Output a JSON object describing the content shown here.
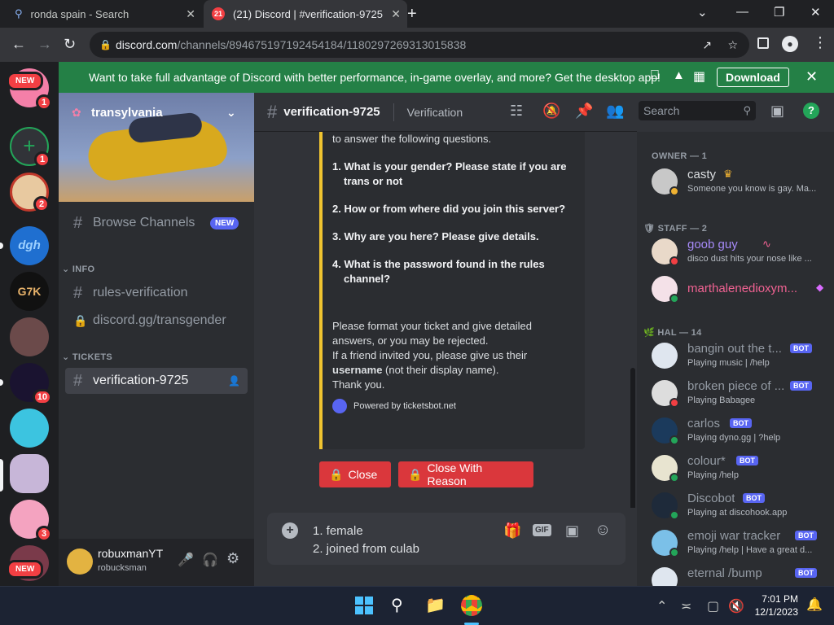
{
  "browser": {
    "tabs": [
      {
        "title": "ronda spain - Search",
        "icon": "search-icon"
      },
      {
        "title": "(21) Discord | #verification-9725",
        "icon": "discord-icon",
        "badge": "21"
      }
    ],
    "url_host": "discord.com",
    "url_path": "/channels/894675197192454184/1180297269313015838"
  },
  "banner": {
    "text": "Want to take full advantage of Discord with better performance, in-game overlay, and more? Get the desktop app!",
    "download_label": "Download",
    "color": "#248046"
  },
  "guilds": [
    {
      "name": "discord-home",
      "badge": "",
      "new_pill": "NEW"
    },
    {
      "name": "pig-server",
      "badge": "1"
    },
    {
      "name": "add-server",
      "badge": "1"
    },
    {
      "name": "avatar-server",
      "badge": "2"
    },
    {
      "name": "dgh-server",
      "label": "dgh",
      "badge": ""
    },
    {
      "name": "g7k-server",
      "label": "G7K",
      "badge": ""
    },
    {
      "name": "girl-server",
      "badge": ""
    },
    {
      "name": "dark-server",
      "badge": "10"
    },
    {
      "name": "anime-server",
      "badge": ""
    },
    {
      "name": "transylvania-server",
      "badge": ""
    },
    {
      "name": "pink-server",
      "badge": "3"
    },
    {
      "name": "bottom-server",
      "badge": "",
      "new_pill": "NEW"
    }
  ],
  "server": {
    "name": "transylvania",
    "browse_label": "Browse Channels",
    "browse_badge": "NEW",
    "categories": [
      {
        "name": "INFO",
        "channels": [
          {
            "name": "rules-verification",
            "icon": "hash-icon"
          },
          {
            "name": "discord.gg/transgender",
            "icon": "lock-icon"
          }
        ]
      },
      {
        "name": "TICKETS",
        "channels": [
          {
            "name": "verification-9725",
            "icon": "hash-icon",
            "active": true
          }
        ]
      }
    ]
  },
  "user": {
    "display": "robuxmanYT",
    "username": "robucksman"
  },
  "channel": {
    "name": "verification-9725",
    "topic": "Verification"
  },
  "search": {
    "placeholder": "Search"
  },
  "embed": {
    "intro": "to answer the following questions.",
    "questions": [
      "1. What is your gender? Please state if you are trans or not",
      "2. How or from where did you join this server?",
      "3. Why are you here? Please give details.",
      "4. What is the password found in the rules channel?"
    ],
    "footer_p1": "Please format your ticket and give detailed answers, or you may be rejected.",
    "footer_p2": "If a friend invited you, please give us their",
    "footer_bold": "username",
    "footer_p3": "(not their display name).",
    "footer_p4": "Thank you.",
    "powered": "Powered by ticketsbot.net",
    "accent": "#f0c430"
  },
  "buttons": {
    "close": "Close",
    "close_reason": "Close With Reason"
  },
  "composer": {
    "line1": "1. female",
    "line2": "2. joined from culab"
  },
  "members": {
    "owner_header": "OWNER — 1",
    "staff_header": "STAFF — 2",
    "hal_header": "HAL — 14",
    "list": [
      {
        "name": "casty",
        "sub": "Someone you know is gay. Ma...",
        "color": "#dbdee1",
        "status": "idle",
        "group": "owner"
      },
      {
        "name": "goob guy",
        "sub": "disco dust hits your nose like ...",
        "color": "#a78bfa",
        "status": "dnd",
        "group": "staff"
      },
      {
        "name": "marthalenedioxym...",
        "sub": "",
        "color": "#f06292",
        "status": "online",
        "group": "staff"
      },
      {
        "name": "bangin out the t...",
        "sub": "Playing music | /help",
        "color": "#949ba4",
        "status": "",
        "bot": "BOT"
      },
      {
        "name": "broken piece of ...",
        "sub": "Playing Babagee",
        "color": "#949ba4",
        "status": "dnd",
        "bot": "BOT"
      },
      {
        "name": "carlos",
        "sub": "Playing dyno.gg | ?help",
        "color": "#949ba4",
        "status": "online",
        "bot": "BOT"
      },
      {
        "name": "colour*",
        "sub": "Playing /help",
        "color": "#949ba4",
        "status": "online",
        "bot": "BOT"
      },
      {
        "name": "Discobot",
        "sub": "Playing at discohook.app",
        "color": "#949ba4",
        "status": "online",
        "bot": "BOT"
      },
      {
        "name": "emoji war tracker",
        "sub": "Playing /help | Have a great d...",
        "color": "#949ba4",
        "status": "online",
        "bot": "BOT"
      },
      {
        "name": "eternal /bump",
        "sub": "",
        "color": "#949ba4",
        "status": "",
        "bot": "BOT"
      }
    ]
  },
  "taskbar": {
    "time": "7:01 PM",
    "date": "12/1/2023"
  }
}
